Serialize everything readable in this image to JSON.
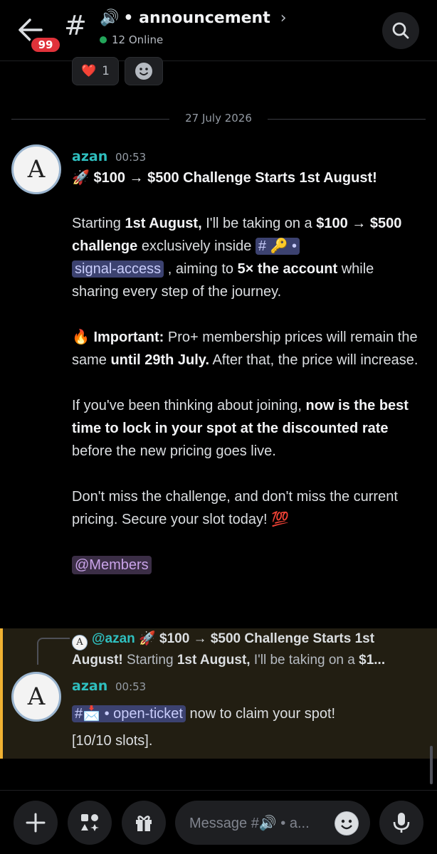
{
  "header": {
    "unread_badge": "99",
    "channel_emoji": "🔊",
    "channel_name": "• announcement",
    "chevron": "›",
    "online_text": "12 Online"
  },
  "reactions": [
    {
      "emoji": "❤️",
      "count": "1"
    }
  ],
  "date_divider": "27 July 2026",
  "message1": {
    "author": "azan",
    "time": "00:53",
    "title_emoji": "🚀",
    "title": "$100 → $500 Challenge Starts 1st August!",
    "p1_a": "Starting ",
    "p1_b": "1st August,",
    "p1_c": " I'll be taking on a ",
    "p1_d": "$100 → $500 challenge",
    "p1_e": " exclusively inside ",
    "p1_channel1": "# 🔑 •",
    "p1_channel2": "signal-access",
    "p1_f": " , aiming to ",
    "p1_g": "5× the account",
    "p1_h": " while sharing every step of the journey.",
    "p2_emoji": "🔥",
    "p2_a": "Important:",
    "p2_b": " Pro+ membership prices will remain the same ",
    "p2_c": "until 29th July.",
    "p2_d": " After that, the price will increase.",
    "p3_a": "If you've been thinking about joining, ",
    "p3_b": "now is the best time to lock in your spot at the discounted rate",
    "p3_c": " before the new pricing goes live.",
    "p4": "Don't miss the challenge, and don't miss the current pricing. Secure your slot today! 💯",
    "mention": "@Members"
  },
  "reply_preview": {
    "mention": "@azan",
    "emoji": "🚀",
    "title": "$100 → $500 Challenge Starts 1st August!",
    "a": " Starting ",
    "b": "1st August,",
    "c": " I'll be taking on a ",
    "d": "$1..."
  },
  "message2": {
    "author": "azan",
    "time": "00:53",
    "channel": "#📩 • open-ticket",
    "text": " now to claim your spot!",
    "line2": "[10/10 slots]."
  },
  "composer": {
    "placeholder": "Message #🔊 • a..."
  },
  "avatar_letter": "A"
}
